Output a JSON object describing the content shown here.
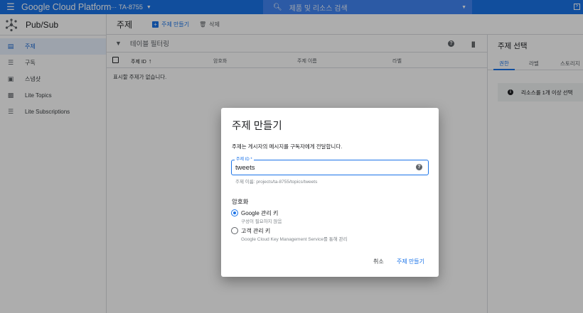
{
  "topbar": {
    "brand": "Google Cloud Platform",
    "project": "TA-8755",
    "search_placeholder": "제품 및 리소스 검색"
  },
  "sidebar": {
    "title": "Pub/Sub",
    "items": [
      {
        "label": "주제",
        "icon": "topic-icon",
        "active": true
      },
      {
        "label": "구독",
        "icon": "list-icon"
      },
      {
        "label": "스냅샷",
        "icon": "snapshot-icon"
      },
      {
        "label": "Lite Topics",
        "icon": "lite-topic-icon"
      },
      {
        "label": "Lite Subscriptions",
        "icon": "list-icon"
      }
    ]
  },
  "header": {
    "title": "주제",
    "create_label": "주제 만들기",
    "delete_label": "삭제"
  },
  "filter": {
    "placeholder": "테이블 필터링"
  },
  "table": {
    "columns": [
      "주제 ID",
      "암호화",
      "주제 이름",
      "라벨"
    ],
    "empty_text": "표시할 주제가 없습니다."
  },
  "right_panel": {
    "title": "주제 선택",
    "tabs": [
      "권한",
      "라벨",
      "스토리지"
    ],
    "info_text": "리소스를 1개 이상 선택"
  },
  "dialog": {
    "title": "주제 만들기",
    "description": "주제는 게시자의 메시지를 구독자에게 전달합니다.",
    "field_label": "주제 ID *",
    "field_value": "tweets",
    "field_hint": "주제 이름: projects/ta-8755/topics/tweets",
    "encryption_label": "암호화",
    "options": [
      {
        "label": "Google 관리 키",
        "sub": "구성이 필요하지 않음",
        "selected": true
      },
      {
        "label": "고객 관리 키",
        "sub": "Google Cloud Key Management Service를 통해 관리",
        "selected": false
      }
    ],
    "cancel_label": "취소",
    "create_label": "주제 만들기"
  },
  "colors": {
    "accent": "#1a73e8",
    "topbar": "#1a73e8",
    "search": "#4285f4"
  }
}
